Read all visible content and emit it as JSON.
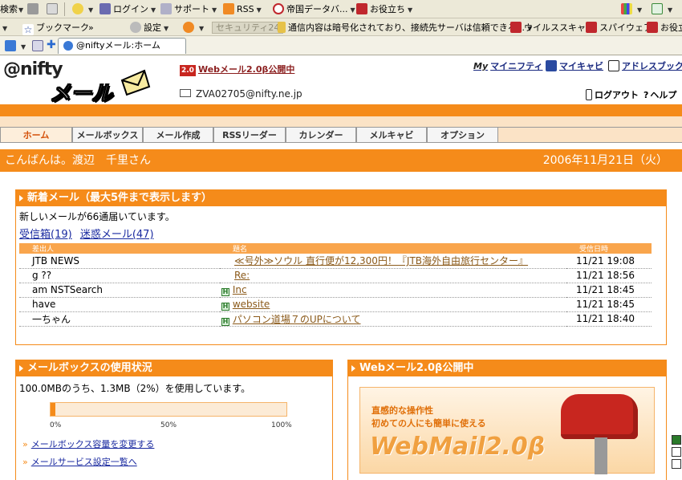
{
  "browser": {
    "toolbar1": {
      "search_label": "検索",
      "login": "ログイン",
      "support": "サポート",
      "rss": "RSS",
      "teikoku": "帝国データバ...",
      "oyakudachi": "お役立ち"
    },
    "toolbar2": {
      "bookmarks": "ブックマーク",
      "settings": "設定",
      "security_badge": "セキュリティ24",
      "security_msg": "通信内容は暗号化されており、接続先サーバは信頼できる...",
      "virus_scan": "ウイルススキャン",
      "spyware": "スパイウェア",
      "oyakudachi2": "お役立"
    },
    "tab_title": "@niftyメール:ホーム"
  },
  "header": {
    "logo_top": "@nifty",
    "logo_bottom": "メール",
    "promo_badge": "2.0",
    "promo_link": "Webメール2.0β公開中",
    "account": "ZVA02705@nifty.ne.jp",
    "links": {
      "mynifty": "マイニフティ",
      "mycabi": "マイキャビ",
      "addressbook": "アドレスブック",
      "logout": "ログアウト",
      "help": "ヘルプ"
    }
  },
  "nav": {
    "tabs": [
      "ホーム",
      "メールボックス",
      "メール作成",
      "RSSリーダー",
      "カレンダー",
      "メルキャビ",
      "オプション"
    ]
  },
  "greeting": {
    "text": "こんばんは。渡辺　千里さん",
    "date": "2006年11月21日（火）"
  },
  "new_mail": {
    "title": "新着メール（最大5件まで表示します）",
    "count_text": "新しいメールが66通届いています。",
    "inbox_link": "受信箱(19)",
    "spam_link": "迷惑メール(47)",
    "columns": [
      "差出人",
      "題名",
      "受信日時"
    ],
    "rows": [
      {
        "from": "JTB NEWS",
        "subject": "≪号外≫ソウル 直行便が12,300円！『JTB海外自由旅行センター』",
        "date": "11/21 19:08",
        "icon": ""
      },
      {
        "from": "g ??",
        "subject": "Re:",
        "date": "11/21 18:56",
        "icon": ""
      },
      {
        "from": "am NSTSearch",
        "subject": "Inc",
        "date": "11/21 18:45",
        "icon": "H"
      },
      {
        "from": "have",
        "subject": "website",
        "date": "11/21 18:45",
        "icon": "H"
      },
      {
        "from": "一ちゃん",
        "subject": "パソコン道場７のUPについて",
        "date": "11/21 18:40",
        "icon": "H"
      }
    ]
  },
  "mailbox_usage": {
    "title": "メールボックスの使用状況",
    "usage_text": "100.0MBのうち、1.3MB（2%）を使用しています。",
    "percent": 2,
    "scale": [
      "0%",
      "50%",
      "100%"
    ],
    "links": [
      "メールボックス容量を変更する",
      "メールサービス設定一覧へ"
    ]
  },
  "webmail_panel": {
    "title": "Webメール2.0β公開中",
    "banner_line1": "直感的な操作性",
    "banner_line2": "初めての人にも簡単に使える",
    "banner_logo": "WebMail2.0β"
  },
  "colors": {
    "accent": "#f58b1a",
    "link": "#1a2aa0"
  }
}
